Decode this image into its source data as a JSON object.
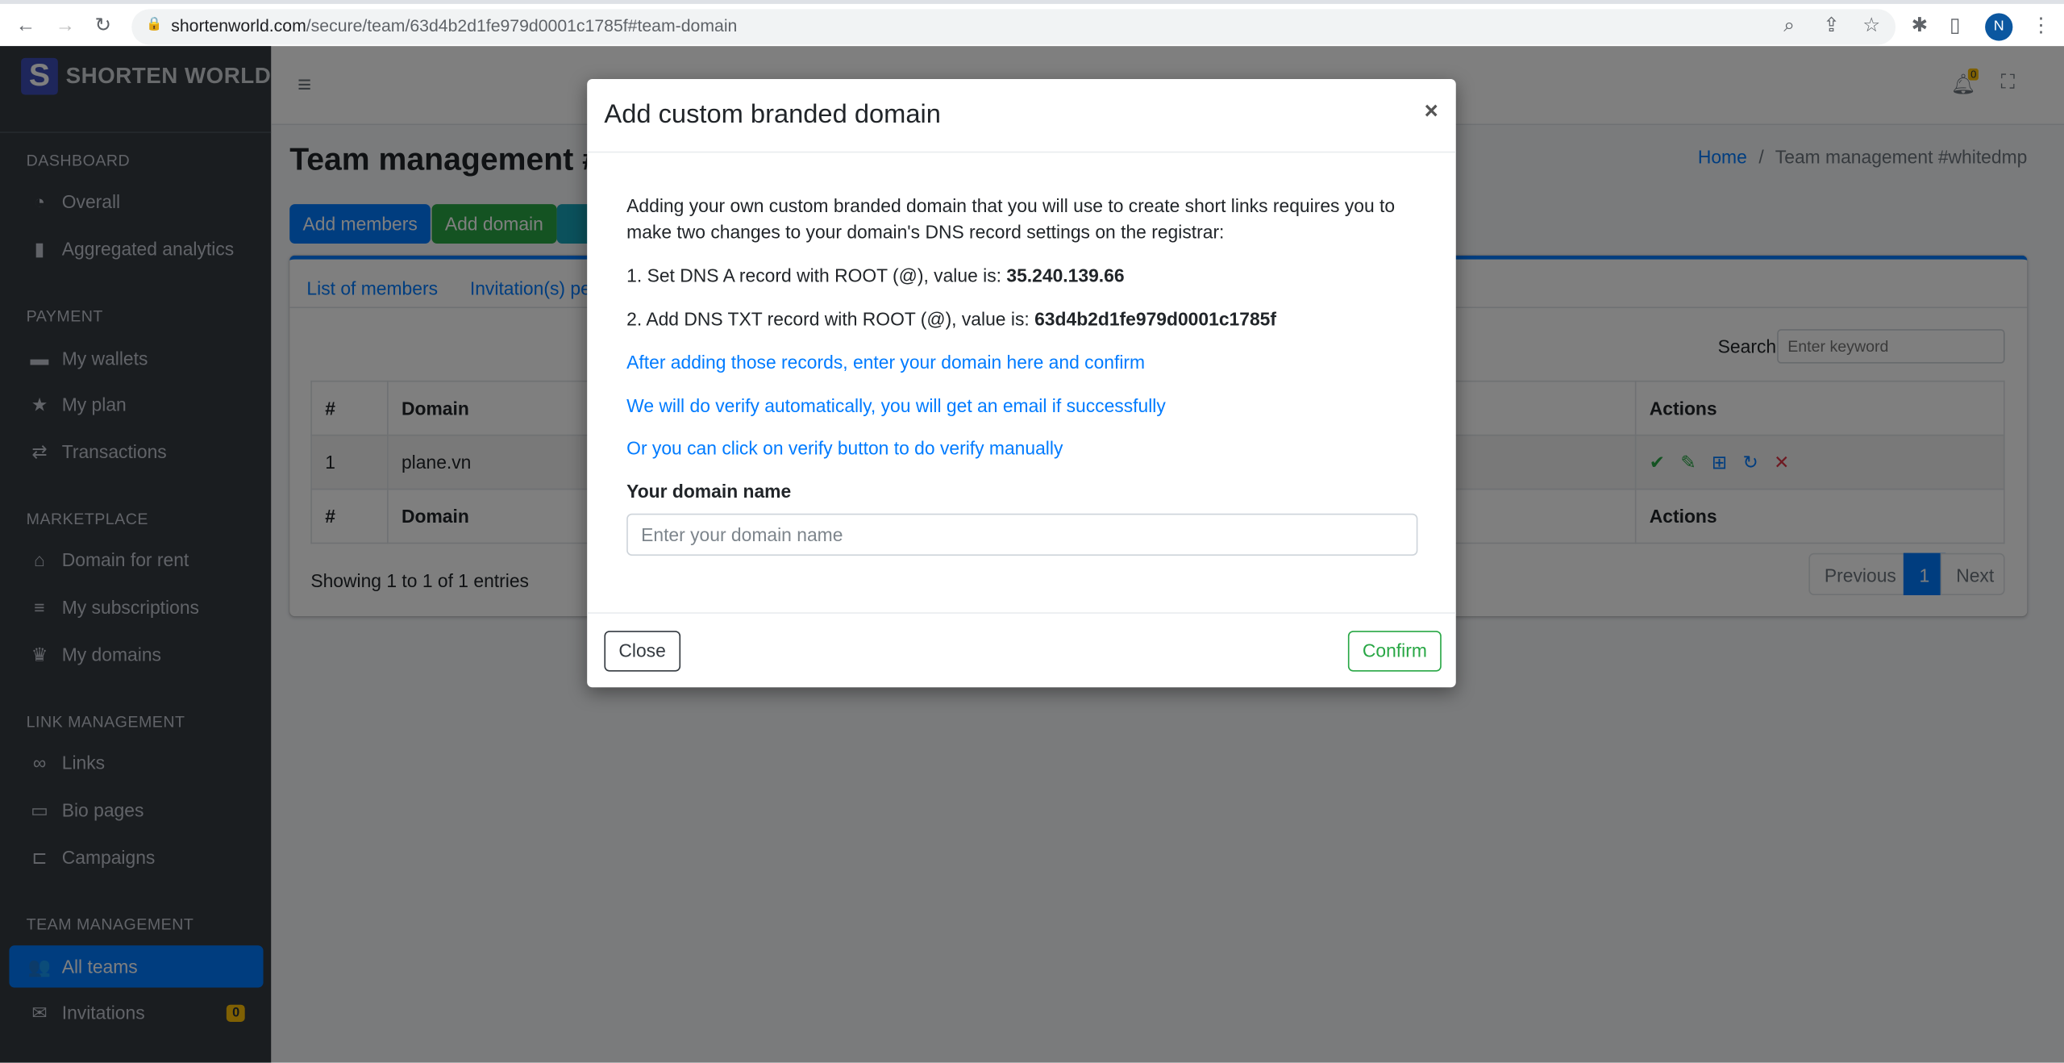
{
  "browser": {
    "url_host": "shortenworld.com",
    "url_path": "/secure/team/63d4b2d1fe979d0001c1785f#team-domain",
    "profile_initial": "N"
  },
  "sidebar": {
    "brand": "SHORTEN WORLD",
    "logo_letter": "S",
    "sections": [
      {
        "title": "DASHBOARD",
        "items": [
          {
            "label": "Overall",
            "icon": "tachometer-icon"
          },
          {
            "label": "Aggregated analytics",
            "icon": "bar-chart-icon"
          }
        ]
      },
      {
        "title": "PAYMENT",
        "items": [
          {
            "label": "My wallets",
            "icon": "wallet-icon"
          },
          {
            "label": "My plan",
            "icon": "star-icon"
          },
          {
            "label": "Transactions",
            "icon": "exchange-icon"
          }
        ]
      },
      {
        "title": "MARKETPLACE",
        "items": [
          {
            "label": "Domain for rent",
            "icon": "store-icon"
          },
          {
            "label": "My subscriptions",
            "icon": "list-icon"
          },
          {
            "label": "My domains",
            "icon": "crown-icon"
          }
        ]
      },
      {
        "title": "LINK MANAGEMENT",
        "items": [
          {
            "label": "Links",
            "icon": "link-icon"
          },
          {
            "label": "Bio pages",
            "icon": "tablet-icon"
          },
          {
            "label": "Campaigns",
            "icon": "folder-tree-icon"
          }
        ]
      },
      {
        "title": "TEAM MANAGEMENT",
        "items": [
          {
            "label": "All teams",
            "icon": "users-icon",
            "active": true
          },
          {
            "label": "Invitations",
            "icon": "envelope-open-icon",
            "badge": "0"
          }
        ]
      }
    ]
  },
  "navbar": {
    "notification_count": "0"
  },
  "page": {
    "title": "Team management #whitedmp",
    "breadcrumb": {
      "home": "Home",
      "current": "Team management #whitedmp"
    },
    "buttons": {
      "add_members": "Add members",
      "add_domain": "Add domain"
    },
    "tabs": [
      "List of members",
      "Invitation(s) pe"
    ],
    "search": {
      "label": "Search",
      "placeholder": "Enter keyword"
    },
    "table": {
      "headers": [
        "#",
        "Domain",
        "Actions"
      ],
      "rows": [
        {
          "num": "1",
          "domain": "plane.vn"
        }
      ]
    },
    "entries_info": "Showing 1 to 1 of 1 entries",
    "pagination": {
      "previous": "Previous",
      "current": "1",
      "next": "Next"
    }
  },
  "modal": {
    "title": "Add custom branded domain",
    "close_x": "×",
    "intro": "Adding your own custom branded domain that you will use to create short links requires you to make two changes to your domain's DNS record settings on the registrar:",
    "step1_text": "1. Set DNS A record with ROOT (@), value is: ",
    "step1_value": "35.240.139.66",
    "step2_text": "2. Add DNS TXT record with ROOT (@), value is: ",
    "step2_value": "63d4b2d1fe979d0001c1785f",
    "note1": "After adding those records, enter your domain here and confirm",
    "note2": "We will do verify automatically, you will get an email if successfully",
    "note3": "Or you can click on verify button to do verify manually",
    "field_label": "Your domain name",
    "field_placeholder": "Enter your domain name",
    "field_value": "",
    "close_button": "Close",
    "confirm_button": "Confirm"
  },
  "colors": {
    "primary": "#007bff",
    "success": "#28a745",
    "info": "#17a2b8",
    "danger": "#dc3545",
    "warning": "#ffc107",
    "sidebar": "#343a40"
  }
}
